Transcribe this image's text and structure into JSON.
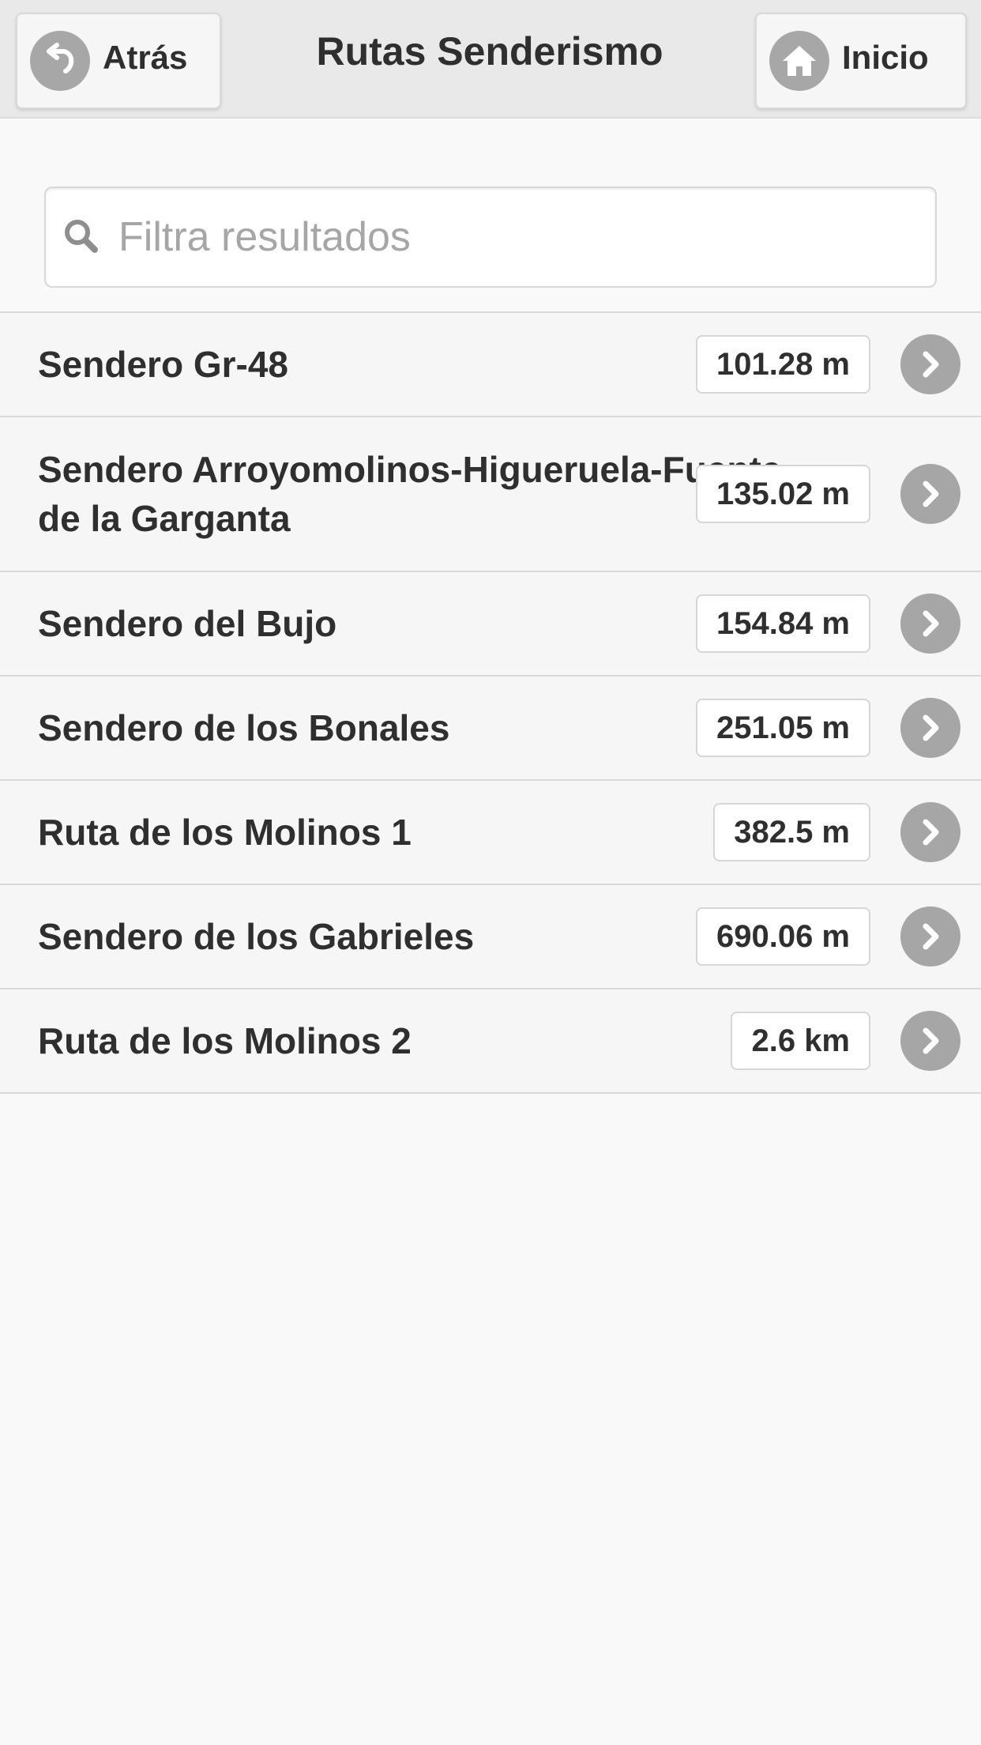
{
  "header": {
    "title": "Rutas Senderismo",
    "back_label": "Atrás",
    "home_label": "Inicio"
  },
  "search": {
    "placeholder": "Filtra resultados",
    "value": ""
  },
  "routes": [
    {
      "name": "Sendero Gr-48",
      "distance": "101.28 m"
    },
    {
      "name": "Sendero Arroyomolinos-Higueruela-Fuente de la Garganta",
      "distance": "135.02 m"
    },
    {
      "name": "Sendero del Bujo",
      "distance": "154.84 m"
    },
    {
      "name": "Sendero de los Bonales",
      "distance": "251.05 m"
    },
    {
      "name": "Ruta de los Molinos 1",
      "distance": "382.5 m"
    },
    {
      "name": "Sendero de los Gabrieles",
      "distance": "690.06 m"
    },
    {
      "name": "Ruta de los Molinos 2",
      "distance": "2.6 km"
    }
  ],
  "colors": {
    "icon_gray": "#a6a6a6",
    "header_bg": "#e9e9e9",
    "page_bg": "#f9f9f9"
  },
  "icons": {
    "back": "back-arrow-icon",
    "home": "home-icon",
    "search": "search-icon",
    "row": "chevron-right-icon"
  }
}
